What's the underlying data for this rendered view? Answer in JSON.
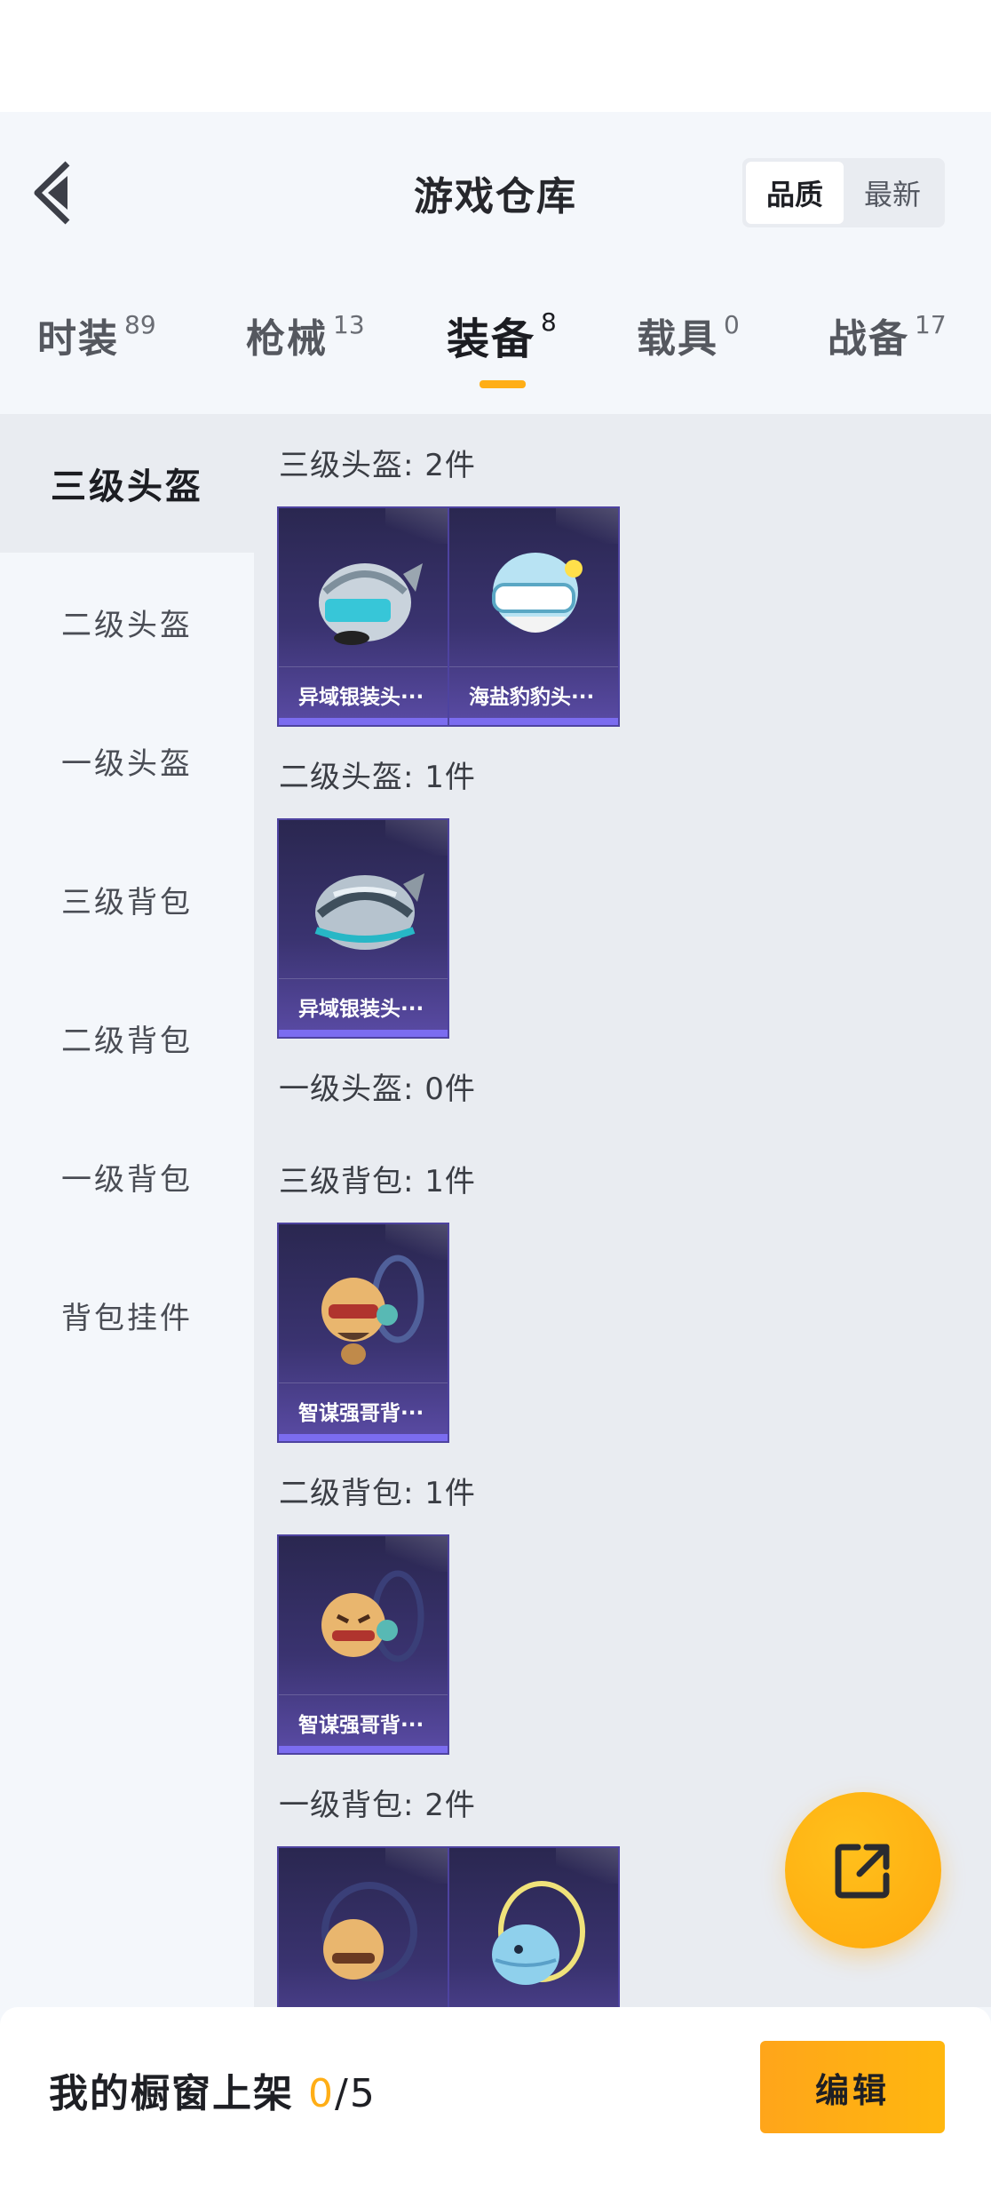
{
  "header": {
    "title": "游戏仓库",
    "sort_options": [
      "品质",
      "最新"
    ]
  },
  "tabs": [
    {
      "label": "时装",
      "count": "89"
    },
    {
      "label": "枪械",
      "count": "13"
    },
    {
      "label": "装备",
      "count": "8"
    },
    {
      "label": "载具",
      "count": "0"
    },
    {
      "label": "战备",
      "count": "17"
    }
  ],
  "sidebar": {
    "items": [
      "三级头盔",
      "二级头盔",
      "一级头盔",
      "三级背包",
      "二级背包",
      "一级背包",
      "背包挂件"
    ]
  },
  "sections": [
    {
      "title": "三级头盔: 2件",
      "items": [
        {
          "name": "异域银装头···",
          "icon": "silver-helmet-icon"
        },
        {
          "name": "海盐豹豹头···",
          "icon": "seal-helmet-icon"
        }
      ]
    },
    {
      "title": "二级头盔: 1件",
      "items": [
        {
          "name": "异域银装头···",
          "icon": "silver-helmet-icon"
        }
      ]
    },
    {
      "title": "一级头盔: 0件",
      "items": []
    },
    {
      "title": "三级背包: 1件",
      "items": [
        {
          "name": "智谋强哥背···",
          "icon": "character-backpack-icon"
        }
      ]
    },
    {
      "title": "二级背包: 1件",
      "items": [
        {
          "name": "智谋强哥背···",
          "icon": "character-backpack-icon"
        }
      ]
    },
    {
      "title": "一级背包: 2件",
      "items": [
        {
          "name": "",
          "icon": "character-backpack-icon"
        },
        {
          "name": "",
          "icon": "fish-backpack-icon"
        }
      ]
    }
  ],
  "bottom": {
    "showcase_label": "我的橱窗上架",
    "showcase_count": "0",
    "showcase_total": "/5",
    "edit_label": "编辑"
  },
  "colors": {
    "accent": "#ffae16",
    "card_bg": "#3a3370",
    "card_border": "#4e43a0"
  }
}
